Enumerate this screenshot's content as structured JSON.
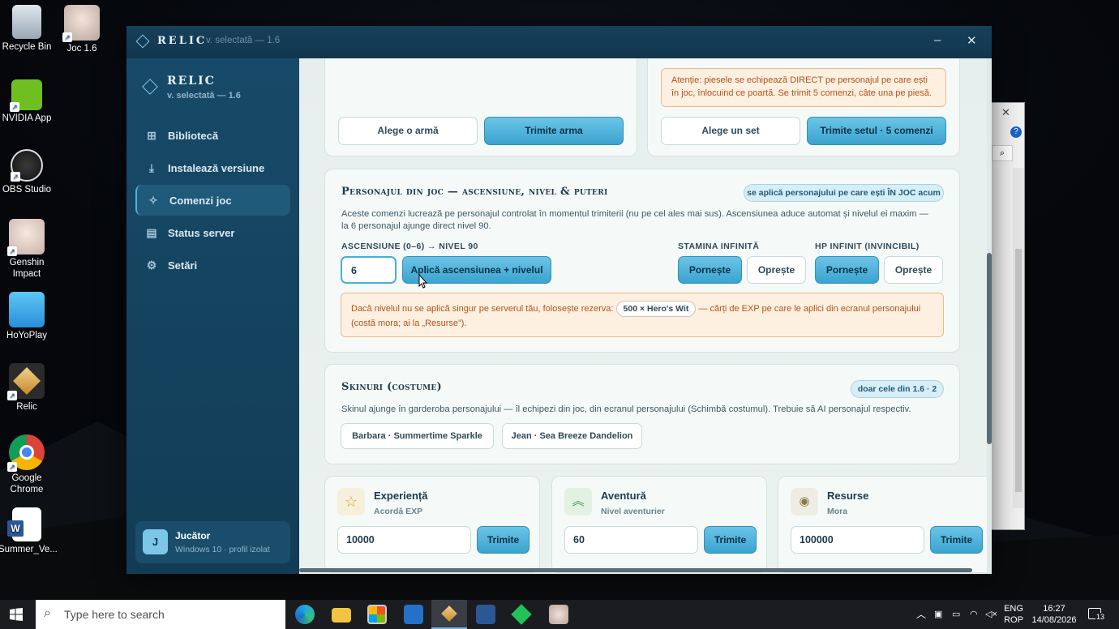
{
  "desktop": {
    "icons": [
      {
        "label": "Recycle Bin"
      },
      {
        "label": "Joc 1.6"
      },
      {
        "label": "NVIDIA App"
      },
      {
        "label": "OBS Studio"
      },
      {
        "label": "Genshin Impact"
      },
      {
        "label": "HoYoPlay"
      },
      {
        "label": "Relic"
      },
      {
        "label": "Google Chrome"
      },
      {
        "label": "Summer_Ve..."
      }
    ]
  },
  "window": {
    "title": "RELIC",
    "version": "v. selectată — 1.6",
    "minimize": "–",
    "close": "✕"
  },
  "sidebar": {
    "app_name": "RELIC",
    "app_version": "v. selectată — 1.6",
    "items": [
      {
        "label": "Bibliotecă",
        "icon": "grid-icon"
      },
      {
        "label": "Instalează versiune",
        "icon": "download-icon"
      },
      {
        "label": "Comenzi joc",
        "icon": "wand-icon"
      },
      {
        "label": "Status server",
        "icon": "server-icon"
      },
      {
        "label": "Setări",
        "icon": "gear-icon"
      }
    ],
    "user": {
      "initial": "J",
      "name": "Jucător",
      "subtitle": "Windows 10 · profil izolat"
    }
  },
  "weapon_card": {
    "choose_label": "Alege o armă",
    "send_label": "Trimite arma"
  },
  "artifact_card": {
    "warning": "Atenție: piesele se echipează DIRECT pe personajul pe care ești în joc, înlocuind ce poartă. Se trimit 5 comenzi, câte una pe piesă.",
    "choose_label": "Alege un set",
    "send_label": "Trimite setul · 5 comenzi"
  },
  "character_card": {
    "title": "Personajul din joc — ascensiune, nivel & puteri",
    "badge": "se aplică personajului pe care ești ÎN JOC acum",
    "description": "Aceste comenzi lucrează pe personajul controlat în momentul trimiterii (nu pe cel ales mai sus). Ascensiunea aduce automat și nivelul ei maxim — la 6 personajul ajunge direct nivel 90.",
    "ascension_label": "ASCENSIUNE (0–6) → NIVEL 90",
    "ascension_value": "6",
    "apply_label": "Aplică ascensiunea + nivelul",
    "stamina_label": "STAMINA INFINITĂ",
    "stamina_on": "Pornește",
    "stamina_off": "Oprește",
    "hp_label": "HP INFINIT (INVINCIBIL)",
    "hp_on": "Pornește",
    "hp_off": "Oprește",
    "fallback_before": "Dacă nivelul nu se aplică singur pe serverul tău, folosește rezerva:",
    "fallback_chip": "500 × Hero's Wit",
    "fallback_after": "— cărți de EXP pe care le aplici din ecranul personajului (costă mora; ai la „Resurse”)."
  },
  "skins_card": {
    "title": "Skinuri (costume)",
    "badge": "doar cele din 1.6 · 2",
    "description": "Skinul ajunge în garderoba personajului — îl echipezi din joc, din ecranul personajului (Schimbă costumul). Trebuie să AI personajul respectiv.",
    "skins": [
      "Barbara · Summertime Sparkle",
      "Jean · Sea Breeze Dandelion"
    ]
  },
  "quick_cards": [
    {
      "title": "Experiență",
      "subtitle": "Acordă EXP",
      "value": "10000",
      "send": "Trimite",
      "icon": "star-icon"
    },
    {
      "title": "Aventură",
      "subtitle": "Nivel aventurier",
      "value": "60",
      "send": "Trimite",
      "icon": "chevrons-up-icon"
    },
    {
      "title": "Resurse",
      "subtitle": "Mora",
      "value": "100000",
      "send": "Trimite",
      "icon": "coin-icon"
    }
  ],
  "taskbar": {
    "search_placeholder": "Type here to search",
    "lang_top": "ENG",
    "lang_bottom": "ROP",
    "time": "16:27",
    "date": "14/08/2026",
    "notifications": "13"
  },
  "colors": {
    "accent": "#3aa4d0",
    "sidebar": "#174a68",
    "warning_text": "#b0531c"
  }
}
